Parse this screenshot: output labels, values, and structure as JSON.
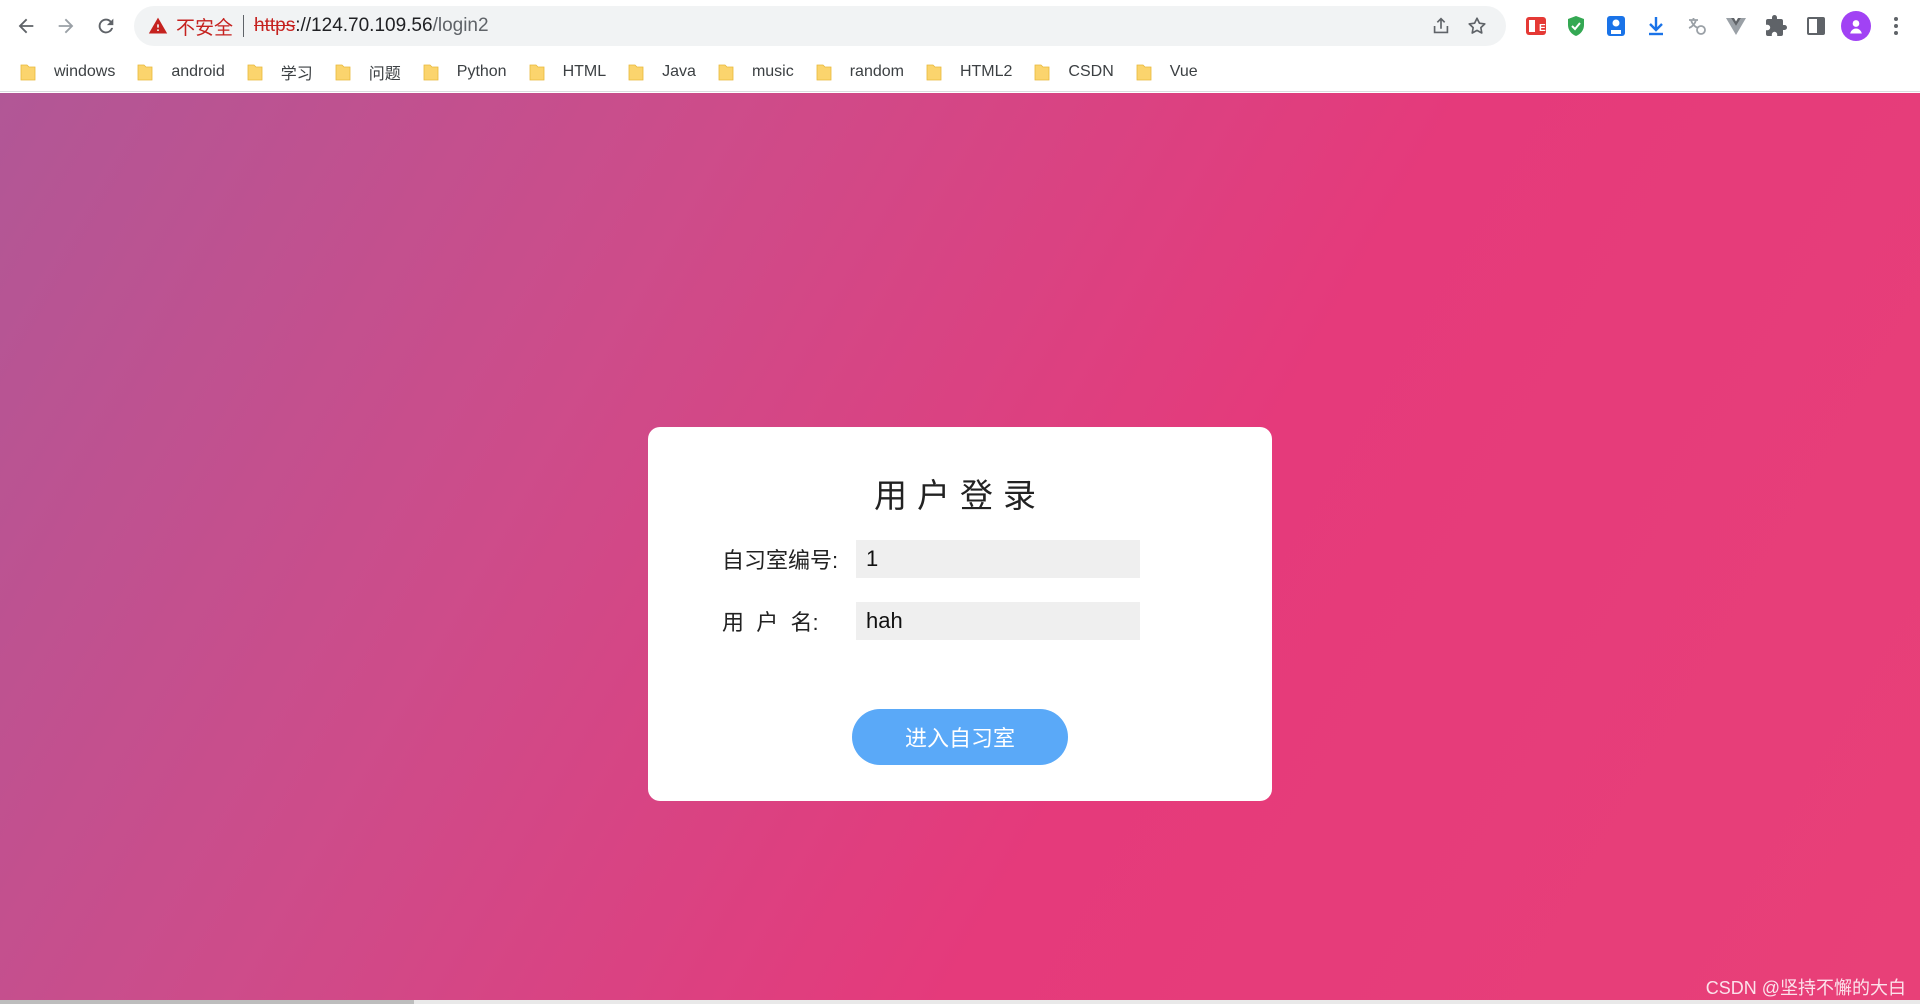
{
  "browser": {
    "security_label": "不安全",
    "url_scheme": "https",
    "url_host": "://124.70.109.56",
    "url_path": "/login2",
    "bookmarks": [
      {
        "label": "windows"
      },
      {
        "label": "android"
      },
      {
        "label": "学习"
      },
      {
        "label": "问题"
      },
      {
        "label": "Python"
      },
      {
        "label": "HTML"
      },
      {
        "label": "Java"
      },
      {
        "label": "music"
      },
      {
        "label": "random"
      },
      {
        "label": "HTML2"
      },
      {
        "label": "CSDN"
      },
      {
        "label": "Vue"
      }
    ],
    "icons": [
      "back-icon",
      "forward-icon",
      "reload-icon",
      "warning-icon",
      "share-icon",
      "star-icon",
      "puzzle-icon",
      "side-panel-icon",
      "menu-icon"
    ]
  },
  "login": {
    "title": "用户登录",
    "room_label": "自习室编号:",
    "room_value": "1",
    "username_label": "用  户  名:",
    "username_value": "hah",
    "submit_label": "进入自习室"
  },
  "watermark": "CSDN @坚持不懈的大白",
  "colors": {
    "gradient_start": "#b15796",
    "gradient_end": "#e84078",
    "button": "#5aa9f8",
    "insecure_red": "#c5221f"
  }
}
